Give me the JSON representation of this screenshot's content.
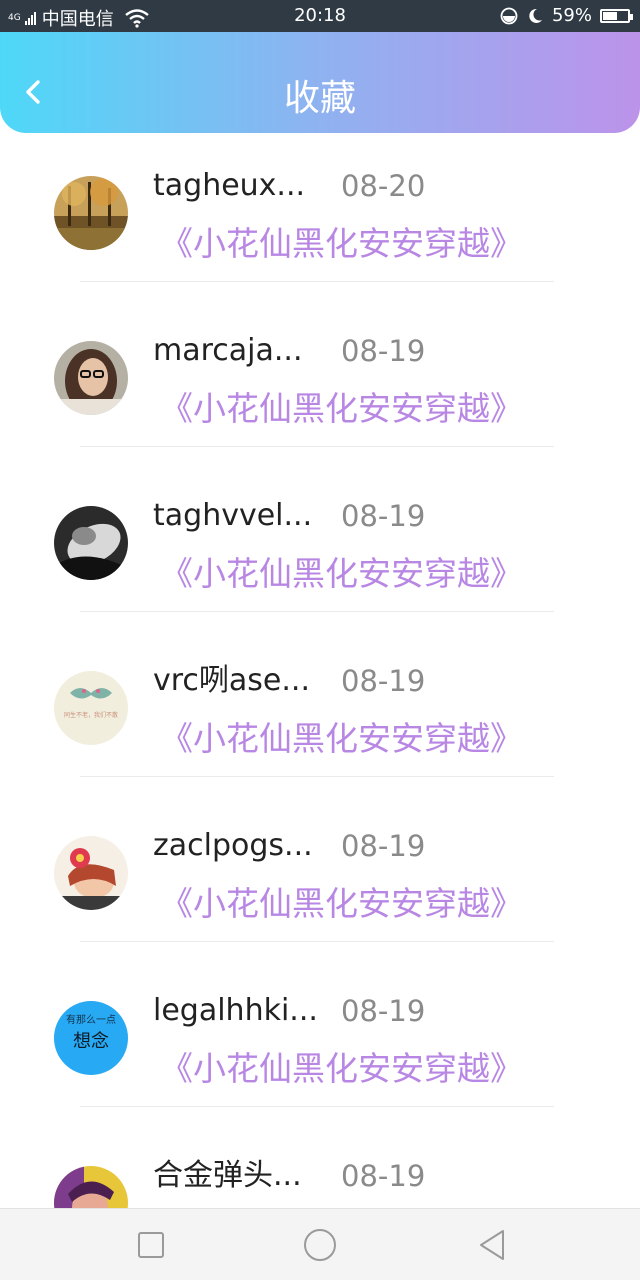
{
  "status_bar": {
    "network": "4G",
    "carrier": "中国电信",
    "time": "20:18",
    "battery_percent": "59%",
    "battery_level": 0.59,
    "icons": [
      "signal-icon",
      "wifi-icon",
      "do-not-disturb-icon",
      "moon-icon",
      "battery-icon"
    ]
  },
  "header": {
    "title": "收藏",
    "back_icon": "chevron-left-icon"
  },
  "theme": {
    "gradient_start": "#4ed8f8",
    "gradient_end": "#bc93ea",
    "accent_text": "#b887e4",
    "date_text": "#8a8a8a"
  },
  "favorites": [
    {
      "user": "tagheux...",
      "date": "08-20",
      "book": "《小花仙黑化安安穿越》",
      "avatar": "autumn-trees-photo"
    },
    {
      "user": "marcaja...",
      "date": "08-19",
      "book": "《小花仙黑化安安穿越》",
      "avatar": "girl-with-glasses-photo"
    },
    {
      "user": "taghvvel...",
      "date": "08-19",
      "book": "《小花仙黑化安安穿越》",
      "avatar": "black-white-portrait-photo"
    },
    {
      "user": "vrc咧ase...",
      "date": "08-19",
      "book": "《小花仙黑化安安穿越》",
      "avatar": "mustache-text-image"
    },
    {
      "user": "zaclpogs...",
      "date": "08-19",
      "book": "《小花仙黑化安安穿越》",
      "avatar": "child-with-flower-photo"
    },
    {
      "user": "legalhhki...",
      "date": "08-19",
      "book": "《小花仙黑化安安穿越》",
      "avatar": "blue-text-image"
    },
    {
      "user": "合金弹头...",
      "date": "08-19",
      "book": "",
      "avatar": "colorful-portrait-photo"
    }
  ],
  "avatar_text": {
    "blue_line1": "有那么一点",
    "blue_line2": "想念",
    "mustache_caption": "同生不老，我们不散"
  },
  "nav_bar": {
    "icons": [
      "square-recent-apps-icon",
      "circle-home-icon",
      "triangle-back-icon"
    ]
  }
}
